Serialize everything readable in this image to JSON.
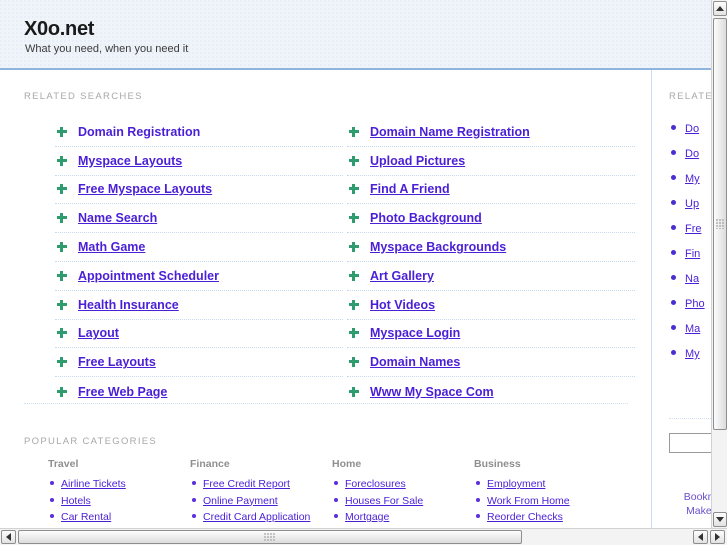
{
  "header": {
    "title": "X0o.net",
    "tagline": "What you need, when you need it"
  },
  "main": {
    "related_label": "RELATED SEARCHES",
    "popular_label": "POPULAR CATEGORIES",
    "related_searches": {
      "left": [
        "Domain Registration",
        "Myspace Layouts",
        "Free Myspace Layouts",
        "Name Search",
        "Math Game",
        "Appointment Scheduler",
        "Health Insurance",
        "Layout",
        "Free Layouts",
        "Free Web Page"
      ],
      "right": [
        "Domain Name Registration",
        "Upload Pictures",
        "Find A Friend",
        "Photo Background",
        "Myspace Backgrounds",
        "Art Gallery",
        "Hot Videos",
        "Myspace Login",
        "Domain Names",
        "Www My Space Com"
      ]
    },
    "categories": [
      {
        "heading": "Travel",
        "items": [
          "Airline Tickets",
          "Hotels",
          "Car Rental"
        ]
      },
      {
        "heading": "Finance",
        "items": [
          "Free Credit Report",
          "Online Payment",
          "Credit Card Application"
        ]
      },
      {
        "heading": "Home",
        "items": [
          "Foreclosures",
          "Houses For Sale",
          "Mortgage"
        ]
      },
      {
        "heading": "Business",
        "items": [
          "Employment",
          "Work From Home",
          "Reorder Checks"
        ]
      }
    ]
  },
  "sidebar": {
    "related_label": "RELATED",
    "items": [
      "Do",
      "Do",
      "My",
      "Up",
      "Fre",
      "Fin",
      "Na",
      "Pho",
      "Ma",
      "My"
    ],
    "search_value": "",
    "bookmark_line1": "Bookmark",
    "bookmark_line2": "Make this"
  },
  "colors": {
    "link": "#4a1fd6",
    "bullet_green": "#2e9c6f",
    "bullet_blue": "#4a2fd0",
    "header_bg": "#eef4fa",
    "header_border": "#8fb4dd",
    "label_gray": "#a8a8a8"
  },
  "scrollbars": {
    "vertical": {
      "up": "▲",
      "down": "▼"
    },
    "horizontal": {
      "left": "◀",
      "right": "▶"
    }
  }
}
